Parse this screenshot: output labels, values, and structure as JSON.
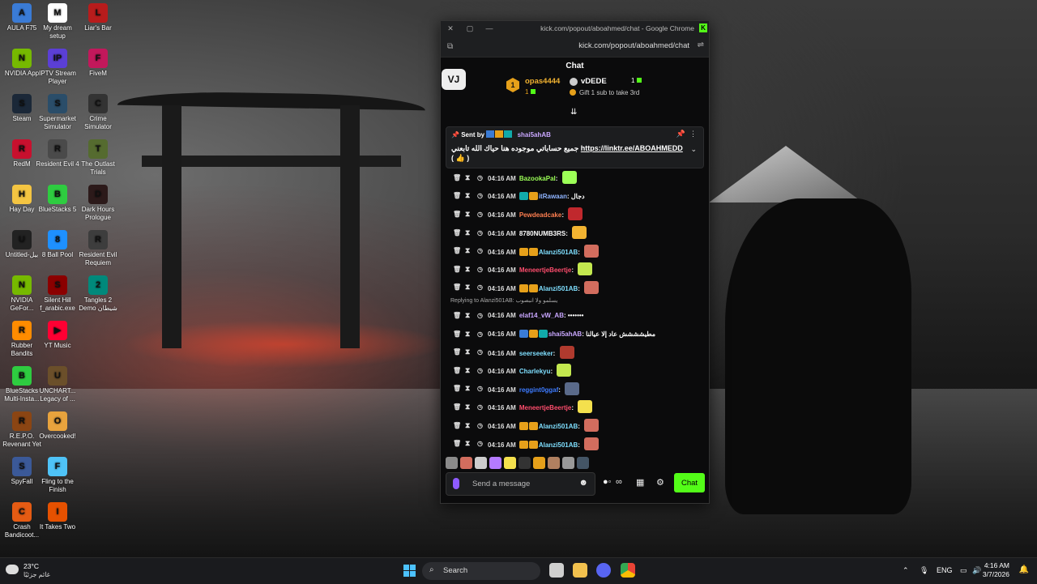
{
  "desktop_icons": [
    {
      "label": "AULA F75",
      "glyph": "A",
      "color": "#3a7bd5"
    },
    {
      "label": "NVIDIA App",
      "glyph": "N",
      "color": "#76b900"
    },
    {
      "label": "Steam",
      "glyph": "S",
      "color": "#1b2838"
    },
    {
      "label": "RedM",
      "glyph": "R",
      "color": "#c8102e"
    },
    {
      "label": "Hay Day",
      "glyph": "H",
      "color": "#f4c542"
    },
    {
      "label": "Untitled-بيل",
      "glyph": "U",
      "color": "#222222"
    },
    {
      "label": "NVIDIA GeFor...",
      "glyph": "N",
      "color": "#76b900"
    },
    {
      "label": "Rubber Bandits",
      "glyph": "R",
      "color": "#ff8c00"
    },
    {
      "label": "BlueStacks Multi-Insta...",
      "glyph": "B",
      "color": "#2ecc40"
    },
    {
      "label": "R.E.P.O. Revenant Yet",
      "glyph": "R",
      "color": "#8b4513"
    },
    {
      "label": "SpyFall",
      "glyph": "S",
      "color": "#3b5998"
    },
    {
      "label": "Crash Bandicoot...",
      "glyph": "C",
      "color": "#e55b13"
    },
    {
      "label": "My dream setup",
      "glyph": "M",
      "color": "#ffffff"
    },
    {
      "label": "IPTV Stream Player",
      "glyph": "IP",
      "color": "#5b3fd6"
    },
    {
      "label": "Supermarket Simulator",
      "glyph": "S",
      "color": "#2a4d69"
    },
    {
      "label": "Resident Evil 4",
      "glyph": "R",
      "color": "#4a4a4a"
    },
    {
      "label": "BlueStacks 5",
      "glyph": "B",
      "color": "#2ecc40"
    },
    {
      "label": "8 Ball Pool",
      "glyph": "8",
      "color": "#1e90ff"
    },
    {
      "label": "Silent Hill f_arabic.exe",
      "glyph": "S",
      "color": "#8b0000"
    },
    {
      "label": "YT Music",
      "glyph": "▶",
      "color": "#ff0033"
    },
    {
      "label": "UNCHART... Legacy of ...",
      "glyph": "U",
      "color": "#6b4f2a"
    },
    {
      "label": "Overcooked!",
      "glyph": "O",
      "color": "#e8a33d"
    },
    {
      "label": "Fling to the Finish",
      "glyph": "F",
      "color": "#4fc3f7"
    },
    {
      "label": "It Takes Two",
      "glyph": "I",
      "color": "#e65100"
    },
    {
      "label": "Liar's Bar",
      "glyph": "L",
      "color": "#b71c1c"
    },
    {
      "label": "FiveM",
      "glyph": "F",
      "color": "#c2185b"
    },
    {
      "label": "Crime Simulator",
      "glyph": "C",
      "color": "#333333"
    },
    {
      "label": "The Outlast Trials",
      "glyph": "T",
      "color": "#556b2f"
    },
    {
      "label": "Dark Hours Prologue",
      "glyph": "D",
      "color": "#2c1a1a"
    },
    {
      "label": "Resident Evil Requiem",
      "glyph": "R",
      "color": "#3d3d3d"
    },
    {
      "label": "Tangles 2 Demo شيطان",
      "glyph": "2",
      "color": "#00897b"
    }
  ],
  "window": {
    "title": "kick.com/popout/aboahmed/chat - Google Chrome",
    "url": "kick.com/popout/aboahmed/chat",
    "chat_header": "Chat",
    "logo_text": "VJ",
    "accent": "#53fc18"
  },
  "leaderboard": {
    "rank1": {
      "medal": "1",
      "name": "opas4444",
      "count": "1"
    },
    "rank2": {
      "name": "vDEDE",
      "count": "1",
      "gift_text": "Gift 1 sub to take 3rd"
    },
    "arrow": "⇊"
  },
  "pinned": {
    "sent_by": "Sent by",
    "user": "shai5ahAB",
    "message": "جميع حساباتي موجوده هنا حياك الله تابعني",
    "link": "https://linktr.ee/ABOAHMEDD",
    "paren_open": "(",
    "paren_close": ")",
    "emoji": "👍"
  },
  "messages": [
    {
      "time": "04:16 AM",
      "user": "BazookaPal",
      "color": "#9cff57",
      "badges": [],
      "text": "",
      "emote": "#9cff57"
    },
    {
      "time": "04:16 AM",
      "user": "itRawaan",
      "color": "#8fb4ff",
      "badges": [
        "#1aa",
        "#e6a01a"
      ],
      "text": "دجال",
      "emote": ""
    },
    {
      "time": "04:16 AM",
      "user": "Pewdeadcake",
      "color": "#ff7f50",
      "badges": [],
      "text": "",
      "emote": "#c0282d"
    },
    {
      "time": "04:16 AM",
      "user": "8780NUMB3RS",
      "color": "#ffffff",
      "badges": [],
      "text": "",
      "emote": "#f2b331"
    },
    {
      "time": "04:16 AM",
      "user": "Alanzi501AB",
      "color": "#7fdfff",
      "badges": [
        "#e6a01a",
        "#e6a01a"
      ],
      "text": "",
      "emote": "#d26d5e"
    },
    {
      "time": "04:16 AM",
      "user": "MeneertjeBeertje",
      "color": "#ff4d6d",
      "badges": [],
      "text": "",
      "emote": "#c3e84f"
    },
    {
      "time": "04:16 AM",
      "user": "Alanzi501AB",
      "color": "#7fdfff",
      "badges": [
        "#e6a01a",
        "#e6a01a"
      ],
      "text": "",
      "emote": "#d26d5e"
    },
    {
      "reply": "Replying to Alanzi501AB: يسلمو ولا انبصوب"
    },
    {
      "time": "04:16 AM",
      "user": "elaf14_vW_AB",
      "color": "#c9a7ff",
      "badges": [],
      "text": "•••••••",
      "emote": ""
    },
    {
      "time": "04:16 AM",
      "user": "shai5ahAB",
      "color": "#c9a7ff",
      "badges": [
        "#3a7bd5",
        "#e6a01a",
        "#1aa"
      ],
      "text": "مطيشششش عاد إلا عيالنا",
      "emote": ""
    },
    {
      "time": "04:16 AM",
      "user": "seerseeker",
      "color": "#7fdfff",
      "badges": [],
      "text": "",
      "emote": "#b03a2e"
    },
    {
      "time": "04:16 AM",
      "user": "Charlekyu",
      "color": "#7fdfff",
      "badges": [],
      "text": "",
      "emote": "#c3e84f"
    },
    {
      "time": "04:16 AM",
      "user": "reggint0ggaf",
      "color": "#3d7bff",
      "badges": [],
      "text": "",
      "emote": "#5a6a8a"
    },
    {
      "time": "04:16 AM",
      "user": "MeneertjeBeertje",
      "color": "#ff4d6d",
      "badges": [],
      "text": "",
      "emote": "#f4e04d"
    },
    {
      "time": "04:16 AM",
      "user": "Alanzi501AB",
      "color": "#7fdfff",
      "badges": [
        "#e6a01a",
        "#e6a01a"
      ],
      "text": "",
      "emote": "#d26d5e"
    },
    {
      "time": "04:16 AM",
      "user": "Alanzi501AB",
      "color": "#7fdfff",
      "badges": [
        "#e6a01a",
        "#e6a01a"
      ],
      "text": "",
      "emote": "#d26d5e"
    }
  ],
  "emote_bar": [
    "#8a8a8a",
    "#d26d5e",
    "#cccccc",
    "#b47aff",
    "#f4e04d",
    "#333333",
    "#e6a01a",
    "#b08060",
    "#999999",
    "#445566"
  ],
  "composer": {
    "placeholder": "Send a message",
    "send_label": "Chat"
  },
  "taskbar": {
    "temperature": "23°C",
    "condition": "غائم جزئيًا",
    "search_label": "Search",
    "language": "ENG",
    "time": "4:16 AM",
    "date": "3/7/2026"
  }
}
